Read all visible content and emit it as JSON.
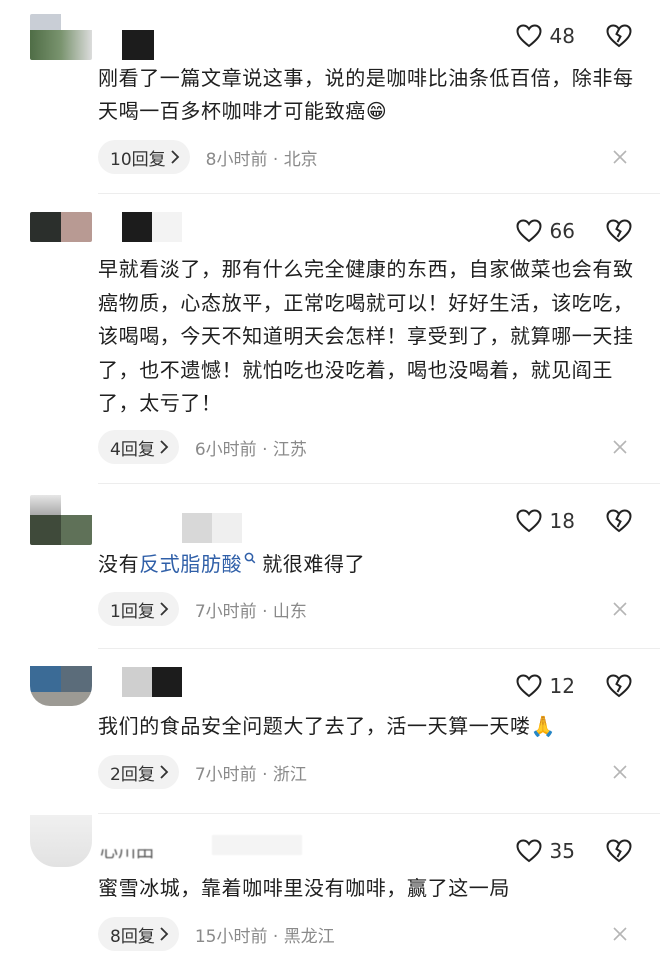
{
  "comments": [
    {
      "likes": "48",
      "text": "刚看了一篇文章说这事，说的是咖啡比油条低百倍，除非每天喝一百多杯咖啡才可能致癌",
      "emoji": "😁",
      "replies": "10回复",
      "time": "8小时前",
      "location": "北京"
    },
    {
      "likes": "66",
      "text": "早就看淡了，那有什么完全健康的东西，自家做菜也会有致癌物质，心态放平，正常吃喝就可以！好好生活，该吃吃，该喝喝，今天不知道明天会怎样！享受到了，就算哪一天挂了，也不遗憾！就怕吃也没吃着，喝也没喝着，就见阎王了，太亏了！",
      "replies": "4回复",
      "time": "6小时前",
      "location": "江苏"
    },
    {
      "likes": "18",
      "text_before": "没有",
      "link": "反式脂肪酸",
      "text_after": "就很难得了",
      "replies": "1回复",
      "time": "7小时前",
      "location": "山东"
    },
    {
      "likes": "12",
      "text": "我们的食品安全问题大了去了，活一天算一天喽",
      "emoji": "🙏",
      "replies": "2回复",
      "time": "7小时前",
      "location": "浙江"
    },
    {
      "likes": "35",
      "partial_name": "心川田",
      "text": "蜜雪冰城，靠着咖啡里没有咖啡，赢了这一局",
      "replies": "8回复",
      "time": "15小时前",
      "location": "黑龙江"
    }
  ],
  "separator": "·",
  "colors": {
    "link": "#2f5fa8",
    "muted": "#8a8a8a",
    "pill": "#f2f2f2"
  }
}
